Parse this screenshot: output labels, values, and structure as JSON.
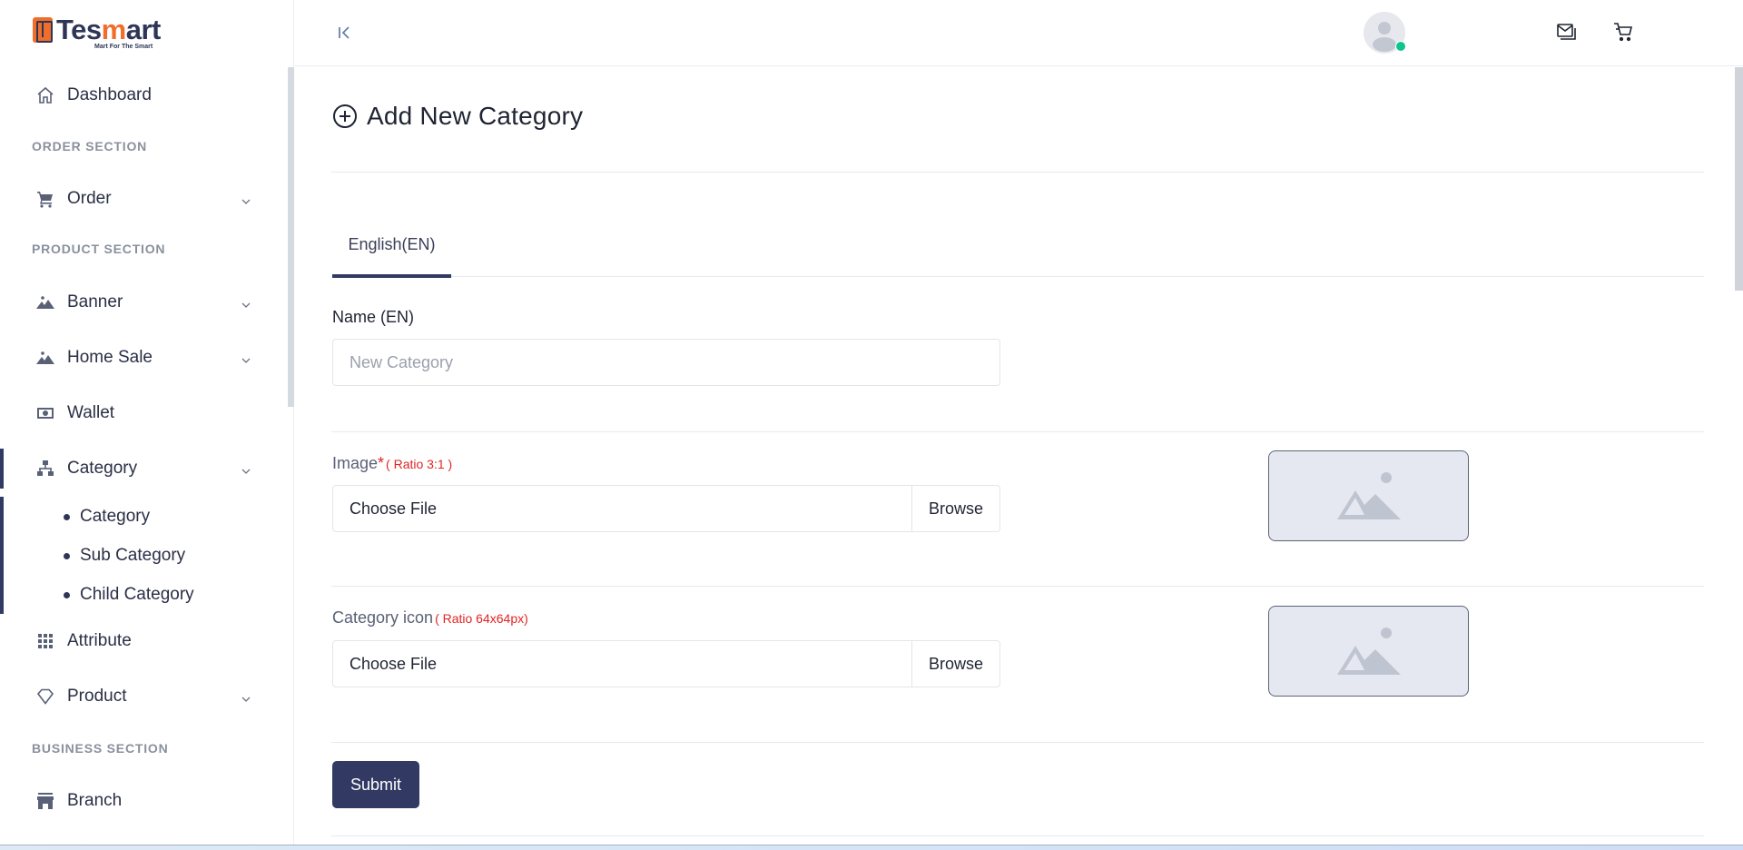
{
  "app": {
    "brand_prefix": "Tes",
    "brand_accent": "m",
    "brand_suffix": "art",
    "tagline": "Mart For The Smart",
    "colors": {
      "primary": "#323a63",
      "accent": "#f06e2b",
      "danger": "#e02424",
      "online": "#10c48e"
    }
  },
  "sidebar": {
    "dashboard": {
      "label": "Dashboard",
      "icon": "home-icon"
    },
    "sections": {
      "order": "ORDER SECTION",
      "product": "PRODUCT SECTION",
      "business": "BUSINESS SECTION"
    },
    "items": {
      "order": {
        "label": "Order",
        "icon": "cart-icon"
      },
      "banner": {
        "label": "Banner",
        "icon": "image-icon"
      },
      "home_sale": {
        "label": "Home Sale",
        "icon": "image-icon"
      },
      "wallet": {
        "label": "Wallet",
        "icon": "money-icon"
      },
      "category": {
        "label": "Category",
        "icon": "sitemap-icon"
      },
      "attribute": {
        "label": "Attribute",
        "icon": "grid-icon"
      },
      "product": {
        "label": "Product",
        "icon": "diamond-icon"
      },
      "branch": {
        "label": "Branch",
        "icon": "store-icon"
      }
    },
    "category_sub": [
      "Category",
      "Sub Category",
      "Child Category"
    ],
    "active": "category"
  },
  "header": {
    "collapse_icon": "collapse-left-icon",
    "mail_icon": "mail-icon",
    "cart_icon": "cart-icon",
    "avatar_status": "online"
  },
  "main": {
    "title": "Add New Category",
    "tabs": [
      {
        "label": "English(EN)",
        "active": true
      }
    ],
    "name_field": {
      "label": "Name (EN)",
      "placeholder": "New Category",
      "value": ""
    },
    "image_field": {
      "label": "Image",
      "required_mark": "*",
      "hint": "( Ratio 3:1 )",
      "file_text": "Choose File",
      "browse": "Browse"
    },
    "icon_field": {
      "label": "Category icon",
      "hint": "( Ratio 64x64px)",
      "file_text": "Choose File",
      "browse": "Browse"
    },
    "submit": "Submit"
  }
}
